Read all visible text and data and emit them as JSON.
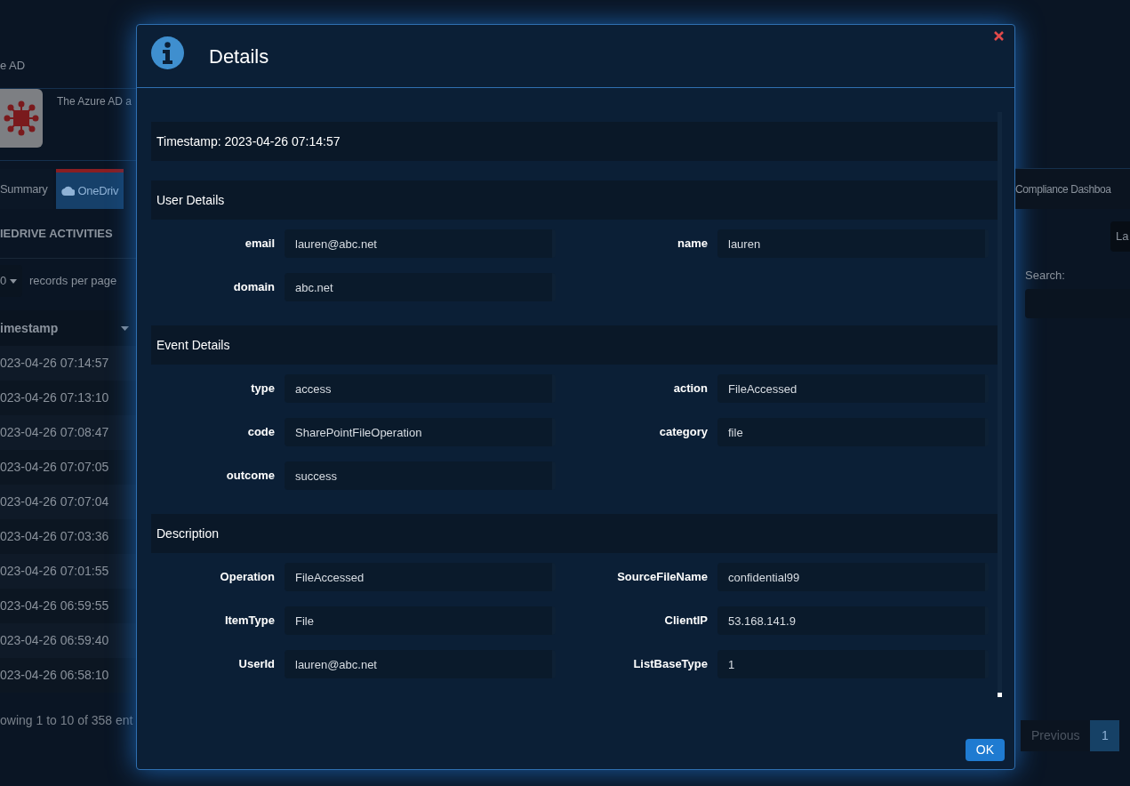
{
  "background": {
    "breadcrumb": "e AD",
    "app_description": "The Azure AD a",
    "tabs_left": [
      {
        "label": "Summary",
        "selected": false
      },
      {
        "label": "OneDriv",
        "selected": true
      }
    ],
    "tabs_right": [
      {
        "label": "Compliance Dashboa",
        "selected": false
      }
    ],
    "panel_title": "IEDRIVE ACTIVITIES",
    "page_length": "0",
    "records_per_page": "records per page",
    "column_1": "imestamp",
    "rows": [
      "023-04-26 07:14:57",
      "023-04-26 07:13:10",
      "023-04-26 07:08:47",
      "023-04-26 07:07:05",
      "023-04-26 07:07:04",
      "023-04-26 07:03:36",
      "023-04-26 07:01:55",
      "023-04-26 06:59:55",
      "023-04-26 06:59:40",
      "023-04-26 06:58:10"
    ],
    "info": "owing 1 to 10 of 358 ent",
    "length_select": "La",
    "search_label": "Search:",
    "pagination": {
      "previous": "Previous",
      "pages": [
        {
          "label": "1",
          "selected": true
        }
      ]
    }
  },
  "modal": {
    "title": "Details",
    "timestamp": "Timestamp: 2023-04-26 07:14:57",
    "sections": [
      {
        "title": "User Details",
        "fields": [
          {
            "label": "email",
            "value": "lauren@abc.net"
          },
          {
            "label": "name",
            "value": "lauren"
          },
          {
            "label": "domain",
            "value": "abc.net"
          }
        ]
      },
      {
        "title": "Event Details",
        "fields": [
          {
            "label": "type",
            "value": "access"
          },
          {
            "label": "action",
            "value": "FileAccessed"
          },
          {
            "label": "code",
            "value": "SharePointFileOperation"
          },
          {
            "label": "category",
            "value": "file"
          },
          {
            "label": "outcome",
            "value": "success"
          }
        ]
      },
      {
        "title": "Description",
        "fields": [
          {
            "label": "Operation",
            "value": "FileAccessed"
          },
          {
            "label": "SourceFileName",
            "value": "confidential99"
          },
          {
            "label": "ItemType",
            "value": "File"
          },
          {
            "label": "ClientIP",
            "value": "53.168.141.9"
          },
          {
            "label": "UserId",
            "value": "lauren@abc.net"
          },
          {
            "label": "ListBaseType",
            "value": "1"
          }
        ]
      }
    ],
    "ok": "OK"
  }
}
